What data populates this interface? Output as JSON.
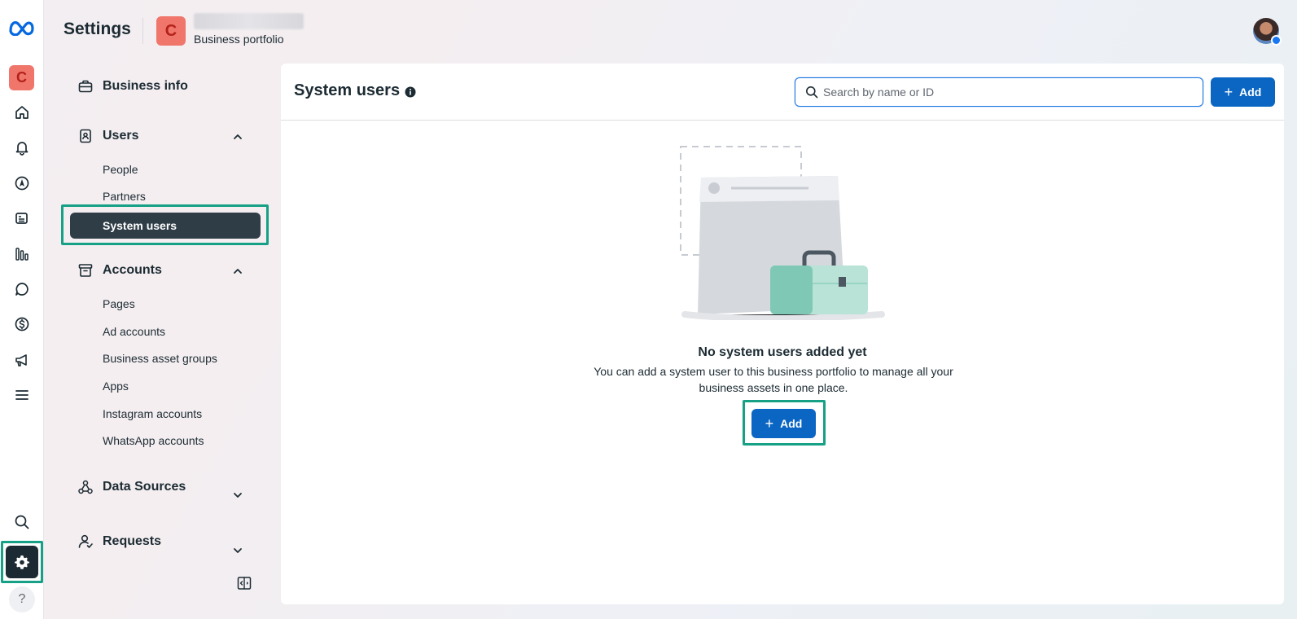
{
  "header": {
    "title": "Settings",
    "portfolio_initial": "C",
    "portfolio_subtitle": "Business portfolio"
  },
  "rail": {
    "avatar_initial": "C",
    "items": [
      {
        "icon": "home-icon"
      },
      {
        "icon": "bell-icon"
      },
      {
        "icon": "navigation-icon"
      },
      {
        "icon": "content-icon"
      },
      {
        "icon": "insights-icon"
      },
      {
        "icon": "chat-icon"
      },
      {
        "icon": "dollar-icon"
      },
      {
        "icon": "megaphone-icon"
      },
      {
        "icon": "menu-icon"
      }
    ],
    "help_label": "?"
  },
  "sidebar": {
    "business_info": "Business info",
    "users": {
      "label": "Users",
      "items": [
        "People",
        "Partners",
        "System users"
      ]
    },
    "accounts": {
      "label": "Accounts",
      "items": [
        "Pages",
        "Ad accounts",
        "Business asset groups",
        "Apps",
        "Instagram accounts",
        "WhatsApp accounts"
      ]
    },
    "data_sources": "Data Sources",
    "requests": "Requests"
  },
  "main": {
    "title": "System users",
    "search_placeholder": "Search by name or ID",
    "add_label": "Add",
    "empty_title": "No system users added yet",
    "empty_desc": "You can add a system user to this business portfolio to manage all your business assets in one place.",
    "empty_add_label": "Add"
  },
  "colors": {
    "accent": "#0a66c2",
    "active_nav": "#2f3d47",
    "highlight": "#16a085",
    "badge": "#f0766b"
  }
}
